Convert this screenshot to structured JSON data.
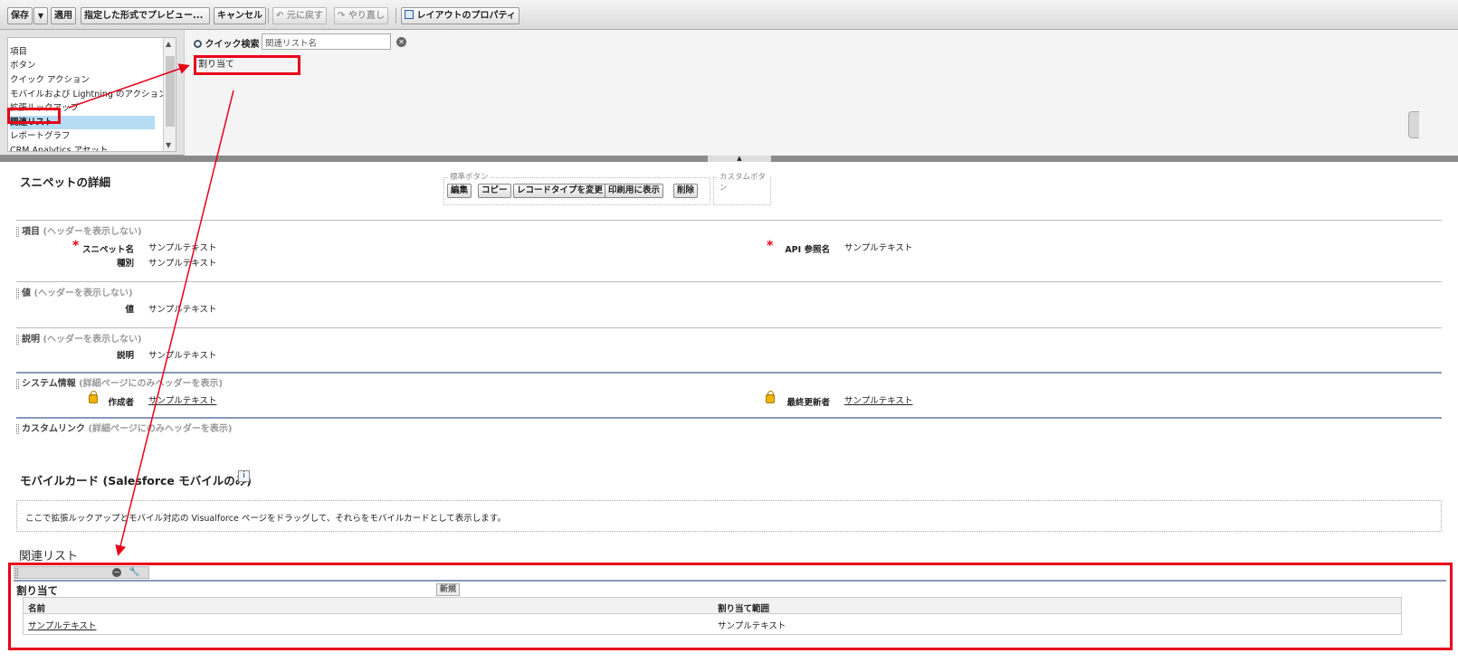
{
  "toolbar": {
    "save": "保存",
    "save_dropdown": "▼",
    "apply": "適用",
    "preview": "指定した形式でプレビュー...",
    "cancel": "キャンセル",
    "undo": "元に戻す",
    "redo": "やり直し",
    "layout_properties": "レイアウトのプロパティ"
  },
  "palette": {
    "categories": [
      "項目",
      "ボタン",
      "クイック アクション",
      "モバイルおよび Lightning のアクション",
      "拡張ルックアップ",
      "関連リスト",
      "レポートグラフ",
      "CRM Analytics アセット"
    ],
    "selected_index": 5,
    "quick_search_label": "クイック検索",
    "quick_search_value": "関連リスト名",
    "items": [
      "割り当て"
    ]
  },
  "detail": {
    "title": "スニペットの詳細",
    "standard_buttons_legend": "標準ボタン",
    "custom_buttons_legend": "カスタムボタン",
    "standard_buttons": [
      "編集",
      "コピー",
      "レコードタイプを変更",
      "印刷用に表示",
      "削除"
    ],
    "sections": [
      {
        "name": "項目",
        "note": "(ヘッダーを表示しない)"
      },
      {
        "name": "値",
        "note": "(ヘッダーを表示しない)"
      },
      {
        "name": "説明",
        "note": "(ヘッダーを表示しない)"
      },
      {
        "name": "システム情報",
        "note": "(詳細ページにのみヘッダーを表示)"
      },
      {
        "name": "カスタムリンク",
        "note": "(詳細ページにのみヘッダーを表示)"
      }
    ],
    "fields": {
      "snippet_name_label": "スニペット名",
      "snippet_name_value": "サンプルテキスト",
      "api_label": "API 参照名",
      "api_value": "サンプルテキスト",
      "type_label": "種別",
      "type_value": "サンプルテキスト",
      "value_label": "値",
      "value_value": "サンプルテキスト",
      "desc_label": "説明",
      "desc_value": "サンプルテキスト",
      "created_by_label": "作成者",
      "created_by_value": "サンプルテキスト",
      "modified_by_label": "最終更新者",
      "modified_by_value": "サンプルテキスト"
    }
  },
  "mobile": {
    "title": "モバイルカード (Salesforce モバイルのみ)",
    "info": "i",
    "hint": "ここで拡張ルックアップとモバイル対応の Visualforce ページをドラッグして、それらをモバイルカードとして表示します。"
  },
  "related": {
    "title": "関連リスト",
    "list_name": "割り当て",
    "new_button": "新規",
    "columns": [
      "名前",
      "割り当て範囲"
    ],
    "row": [
      "サンプルテキスト",
      "サンプルテキスト"
    ]
  },
  "colors": {
    "highlight": "#e8001a",
    "selected": "#b6dcf3"
  }
}
